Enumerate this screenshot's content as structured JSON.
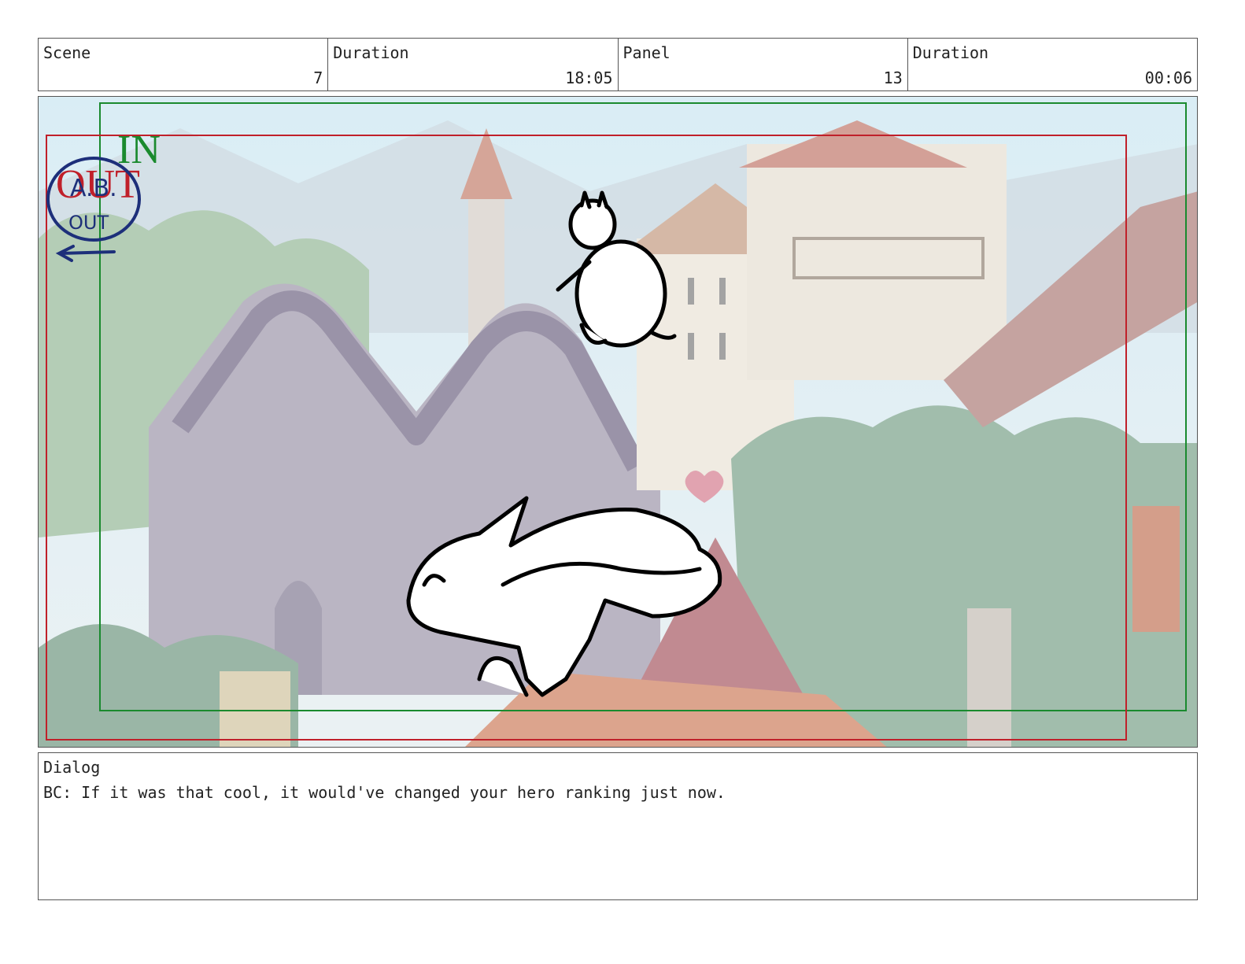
{
  "header": {
    "scene": {
      "label": "Scene",
      "value": "7"
    },
    "scene_duration": {
      "label": "Duration",
      "value": "18:05"
    },
    "panel": {
      "label": "Panel",
      "value": "13"
    },
    "panel_duration": {
      "label": "Duration",
      "value": "00:06"
    }
  },
  "frame_marks": {
    "in_label": "IN",
    "out_label": "OUT",
    "note_line1": "A.B.",
    "note_line2": "OUT"
  },
  "dialog": {
    "label": "Dialog",
    "text": "BC: If it was that cool, it would've changed your hero ranking just now."
  },
  "colors": {
    "in_frame": "#1a8a2e",
    "out_frame": "#c0202a",
    "note_ink": "#1d2f7a",
    "border": "#555555"
  }
}
